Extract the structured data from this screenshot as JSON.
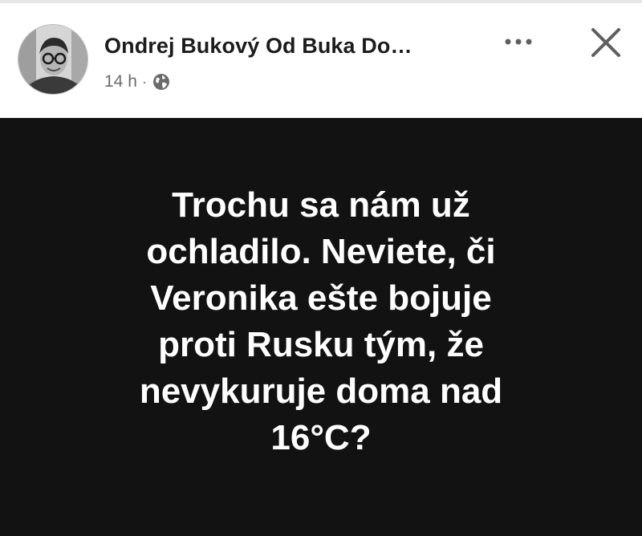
{
  "post": {
    "author": "Ondrej Bukový Od Buka Do…",
    "timestamp": "14 h",
    "separator": "·",
    "audience_icon": "globe-icon",
    "more_icon": "more-options-icon",
    "close_icon": "close-icon",
    "text_lines": [
      "Trochu sa nám už",
      "ochladilo. Neviete, či",
      "Veronika ešte bojuje",
      "proti Rusku tým, že",
      "nevykuruje doma nad",
      "16°C?"
    ]
  },
  "colors": {
    "header_bg": "#ffffff",
    "post_bg": "#121212",
    "post_text": "#ffffff",
    "author_text": "#1c1c1c",
    "meta_text": "#6b6b6b",
    "icon": "#5f5f5f"
  }
}
